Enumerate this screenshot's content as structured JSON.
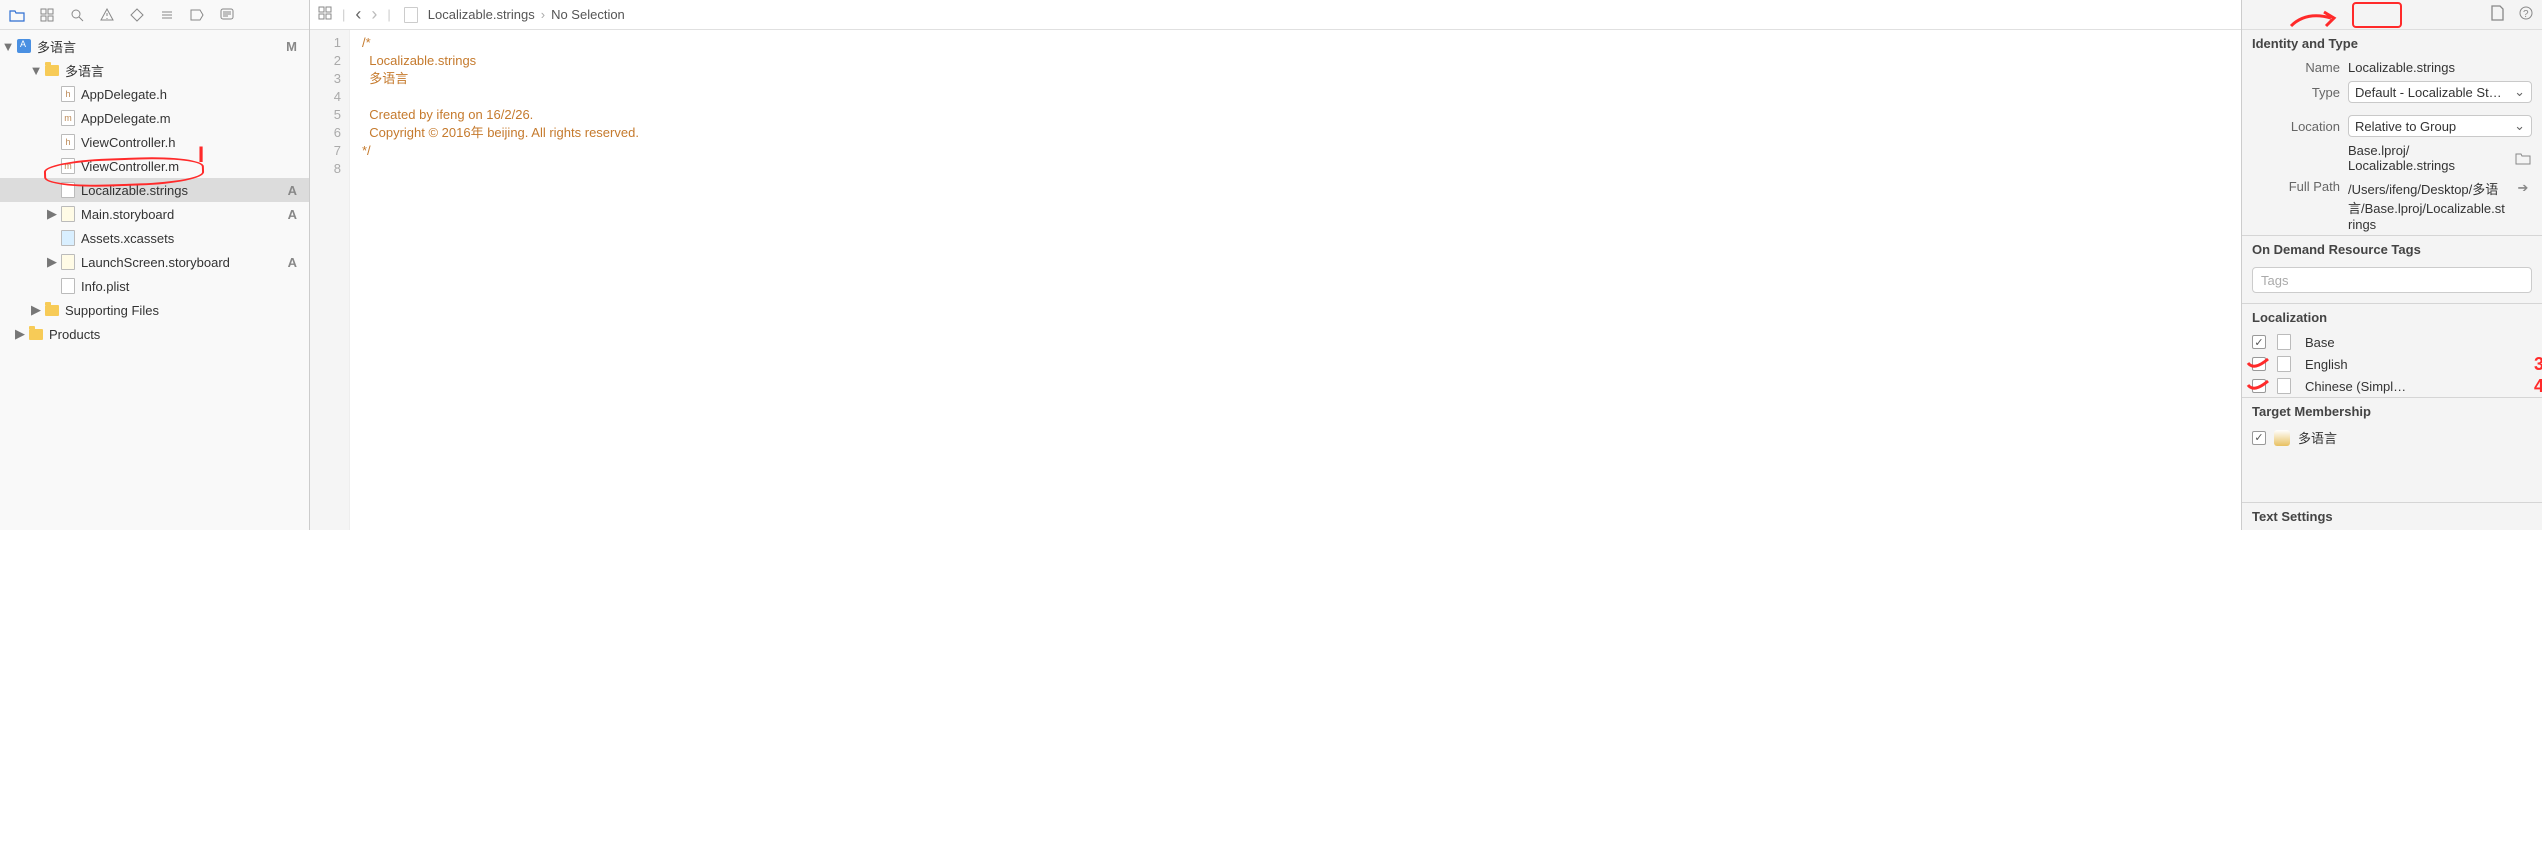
{
  "navigator": {
    "project": {
      "name": "多语言",
      "badge": "M"
    },
    "tree": [
      {
        "depth": 1,
        "icon": "folder-yellow",
        "name": "多语言",
        "expandable": true,
        "expanded": true
      },
      {
        "depth": 2,
        "icon": "h",
        "name": "AppDelegate.h"
      },
      {
        "depth": 2,
        "icon": "m",
        "name": "AppDelegate.m"
      },
      {
        "depth": 2,
        "icon": "h",
        "name": "ViewController.h"
      },
      {
        "depth": 2,
        "icon": "m",
        "name": "ViewController.m"
      },
      {
        "depth": 2,
        "icon": "blank",
        "name": "Localizable.strings",
        "badge": "A",
        "selected": true
      },
      {
        "depth": 2,
        "icon": "sb",
        "name": "Main.storyboard",
        "badge": "A",
        "expandable": true
      },
      {
        "depth": 2,
        "icon": "assets",
        "name": "Assets.xcassets"
      },
      {
        "depth": 2,
        "icon": "sb",
        "name": "LaunchScreen.storyboard",
        "badge": "A",
        "expandable": true
      },
      {
        "depth": 2,
        "icon": "blank",
        "name": "Info.plist"
      },
      {
        "depth": 1,
        "icon": "folder-yellow",
        "name": "Supporting Files",
        "expandable": true
      },
      {
        "depth": 0,
        "icon": "folder-yellow",
        "name": "Products",
        "expandable": true
      }
    ]
  },
  "editor": {
    "breadcrumb": {
      "file": "Localizable.strings",
      "selection": "No Selection"
    },
    "lines": [
      "1",
      "2",
      "3",
      "4",
      "5",
      "6",
      "7",
      "8"
    ],
    "code": "/*\n  Localizable.strings\n  多语言\n\n  Created by ifeng on 16/2/26.\n  Copyright © 2016年 beijing. All rights reserved.\n*/\n"
  },
  "inspector": {
    "identity_title": "Identity and Type",
    "name_label": "Name",
    "name_value": "Localizable.strings",
    "type_label": "Type",
    "type_value": "Default - Localizable St…",
    "location_label": "Location",
    "location_value": "Relative to Group",
    "path_rel": "Base.lproj/\nLocalizable.strings",
    "fullpath_label": "Full Path",
    "fullpath_value": "/Users/ifeng/Desktop/多语言/Base.lproj/Localizable.strings",
    "tags_title": "On Demand Resource Tags",
    "tags_placeholder": "Tags",
    "localization_title": "Localization",
    "localizations": [
      {
        "name": "Base",
        "checked": true
      },
      {
        "name": "English",
        "checked": false
      },
      {
        "name": "Chinese (Simpl…",
        "checked": false
      }
    ],
    "target_title": "Target Membership",
    "targets": [
      {
        "name": "多语言",
        "checked": true
      }
    ],
    "text_settings_title": "Text Settings"
  }
}
